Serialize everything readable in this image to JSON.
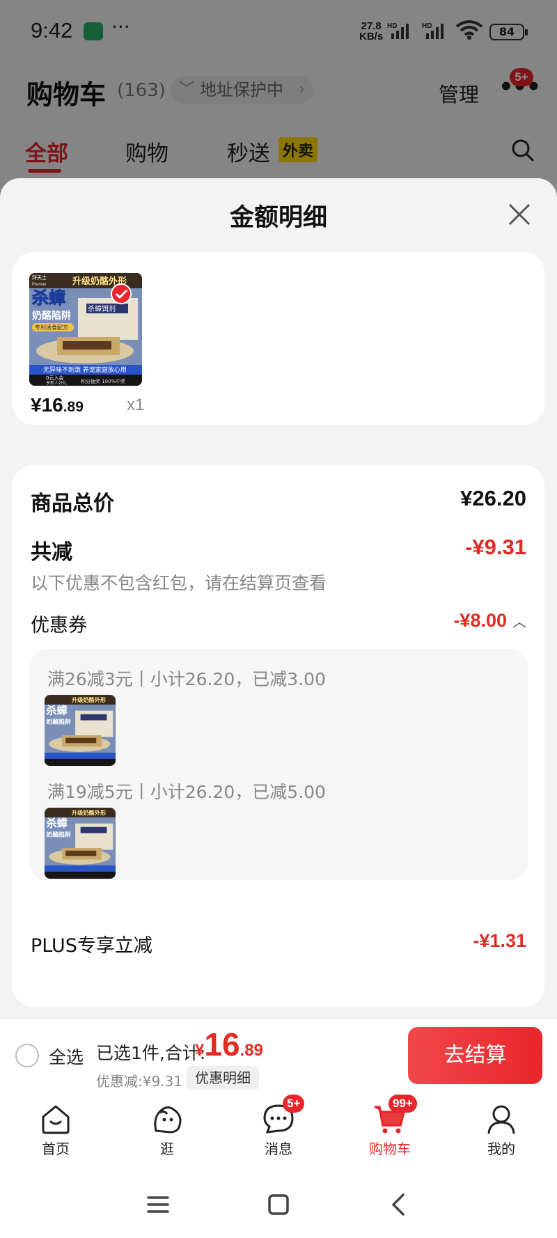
{
  "status_bar": {
    "time": "9:42",
    "network_speed_value": "27.8",
    "network_speed_unit": "KB/s",
    "signal1": "HD",
    "signal2": "HD",
    "battery": "84"
  },
  "cart_header": {
    "title": "购物车",
    "count": "(163)",
    "address_status": "地址保护中",
    "manage_label": "管理",
    "more_badge": "5+"
  },
  "tabs": [
    {
      "label": "全部",
      "active": true
    },
    {
      "label": "购物"
    },
    {
      "label": "秒送"
    }
  ],
  "takeout_badge": "外卖",
  "sheet": {
    "title": "金额明细",
    "product": {
      "price_main": "¥16",
      "price_cents": ".89",
      "quantity": "x1"
    },
    "summary": {
      "total_label": "商品总价",
      "total_value": "¥26.20",
      "reduce_label": "共减",
      "reduce_value": "-¥9.31",
      "note": "以下优惠不包含红包，请在结算页查看",
      "coupon_label": "优惠券",
      "coupon_value": "-¥8.00",
      "coupons": [
        {
          "text": "满26减3元丨小计26.20，已减3.00"
        },
        {
          "text": "满19减5元丨小计26.20，已减5.00"
        }
      ],
      "plus_label": "PLUS专享立减",
      "plus_value": "-¥1.31"
    }
  },
  "product_image": {
    "brand": "拜天士",
    "brand_en": "Premier",
    "banner": "升级奶酪外形",
    "title1": "杀蟑",
    "title2": "奶酪陷阱",
    "subtitle": "专利诱食配方",
    "package": "杀蟑饵剂",
    "benefit": "无异味不刺激 养宠家庭放心用",
    "badge": "0元入会",
    "badge_sub": "享新人好礼",
    "footer": "积分抽奖 100%中奖"
  },
  "action_bar": {
    "select_all": "全选",
    "selected_text": "已选1件,合计:",
    "total_symbol": "¥",
    "total_main": "16",
    "total_cents": ".89",
    "discount_text": "优惠减:¥9.31",
    "detail_button": "优惠明细",
    "checkout_button": "去结算"
  },
  "bottom_nav": [
    {
      "label": "首页",
      "icon": "home-icon"
    },
    {
      "label": "逛",
      "icon": "browse-icon"
    },
    {
      "label": "消息",
      "icon": "message-icon",
      "badge": "5+"
    },
    {
      "label": "购物车",
      "icon": "cart-icon",
      "badge": "99+",
      "active": true
    },
    {
      "label": "我的",
      "icon": "profile-icon"
    }
  ],
  "colors": {
    "accent": "#e8262c",
    "price_red": "#e32b24",
    "takeout_yellow": "#ffd500"
  }
}
